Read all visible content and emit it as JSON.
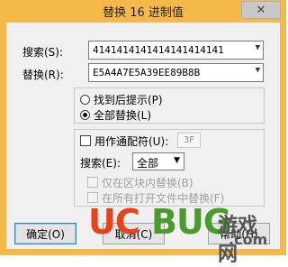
{
  "window": {
    "title": "替换 16 进制值",
    "close_glyph": "✕"
  },
  "search": {
    "label": "搜索(S):",
    "value": "4141414141414141414141"
  },
  "replace": {
    "label": "替换(R):",
    "value": "E5A4A7E5A39EE89B8B"
  },
  "scope": {
    "options": [
      {
        "label": "找到后提示(P)",
        "checked": false
      },
      {
        "label": "全部替换(L)",
        "checked": true
      }
    ]
  },
  "wildcard": {
    "label": "用作通配符(U):",
    "value": "3F",
    "checked": false
  },
  "search_scope": {
    "label": "搜索(E):",
    "selected": "全部"
  },
  "extra_options": [
    {
      "label": "仅在区块内替换(B)",
      "enabled": false
    },
    {
      "label": "在所有打开文件中替换(F)",
      "enabled": false
    }
  ],
  "buttons": {
    "ok": "确定(O)",
    "cancel": "取消(C)",
    "help": "帮助(H)"
  },
  "watermark": {
    "uc": "UC",
    "bug": "BUG",
    "cn": "游戏网",
    "com": ".com"
  },
  "colors": {
    "frame": "#f5b94a",
    "client": "#f0f0f0",
    "wm_red": "#e8421c",
    "wm_green": "#4a9a2f"
  }
}
